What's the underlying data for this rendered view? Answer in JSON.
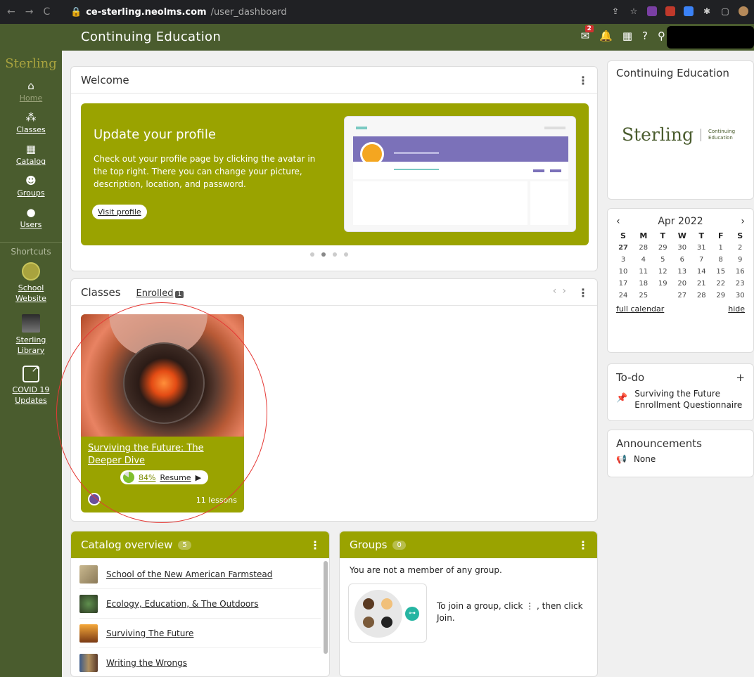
{
  "browser": {
    "domain": "ce-sterling.neolms.com",
    "path": "/user_dashboard"
  },
  "header": {
    "title": "Continuing Education",
    "notification_count": "2"
  },
  "sidebar": {
    "logo": "Sterling",
    "items": [
      {
        "label": "Home",
        "icon": "home-icon"
      },
      {
        "label": "Classes",
        "icon": "classes-icon"
      },
      {
        "label": "Catalog",
        "icon": "catalog-icon"
      },
      {
        "label": "Groups",
        "icon": "groups-icon"
      },
      {
        "label": "Users",
        "icon": "user-icon"
      }
    ],
    "shortcuts_title": "Shortcuts",
    "shortcuts": [
      {
        "line1": "School",
        "line2": "Website"
      },
      {
        "line1": "Sterling",
        "line2": "Library"
      },
      {
        "line1": "COVID 19",
        "line2": "Updates"
      }
    ]
  },
  "welcome": {
    "title": "Welcome",
    "banner_title": "Update your profile",
    "banner_text": "Check out your profile page by clicking the avatar in the top right. There you can change your picture, description, location, and password.",
    "button": "Visit profile"
  },
  "classes": {
    "title": "Classes",
    "tab": "Enrolled",
    "tab_count": "1",
    "course": {
      "title": "Surviving the Future: The Deeper Dive",
      "progress": "84%",
      "resume": "Resume",
      "lessons": "11 lessons"
    }
  },
  "catalog": {
    "title": "Catalog overview",
    "count": "5",
    "items": [
      "School of the New American Farmstead",
      "Ecology, Education, & The Outdoors",
      "Surviving The Future",
      "Writing the Wrongs"
    ]
  },
  "groups": {
    "title": "Groups",
    "count": "0",
    "message": "You are not a member of any group.",
    "join_text": "To join a group, click ⋮ , then click Join."
  },
  "ce_panel": {
    "title": "Continuing Education",
    "logo": "Sterling",
    "logo_sub1": "Continuing",
    "logo_sub2": "Education"
  },
  "calendar": {
    "month": "Apr 2022",
    "days": [
      "S",
      "M",
      "T",
      "W",
      "T",
      "F",
      "S"
    ],
    "weeks": [
      [
        "27",
        "28",
        "29",
        "30",
        "31",
        "1",
        "2"
      ],
      [
        "3",
        "4",
        "5",
        "6",
        "7",
        "8",
        "9"
      ],
      [
        "10",
        "11",
        "12",
        "13",
        "14",
        "15",
        "16"
      ],
      [
        "17",
        "18",
        "19",
        "20",
        "21",
        "22",
        "23"
      ],
      [
        "24",
        "25",
        "",
        "27",
        "28",
        "29",
        "30"
      ]
    ],
    "full_calendar": "full calendar",
    "hide": "hide"
  },
  "todo": {
    "title": "To-do",
    "add": "+",
    "item": "Surviving the Future Enrollment Questionnaire"
  },
  "announcements": {
    "title": "Announcements",
    "item": "None"
  }
}
